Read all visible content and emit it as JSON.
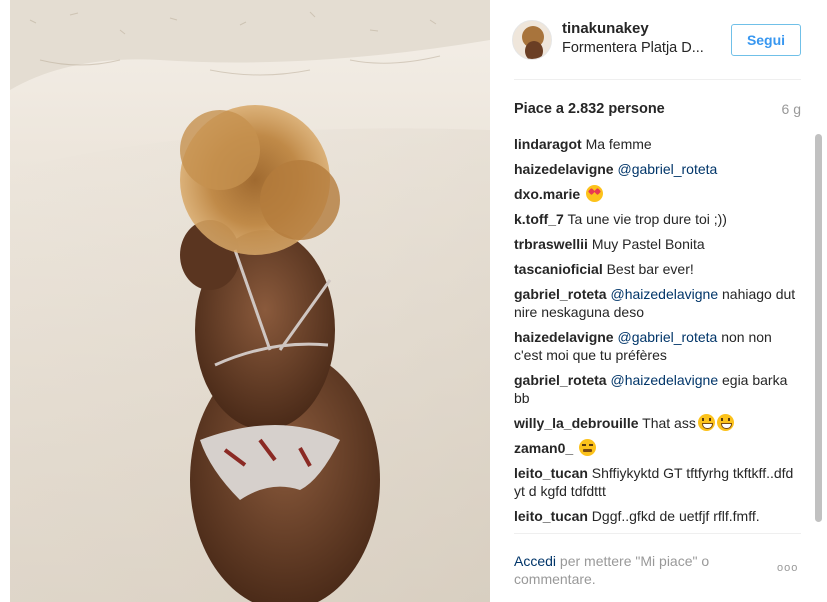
{
  "post": {
    "username": "tinakunakey",
    "location": "Formentera Platja D...",
    "follow_label": "Segui",
    "likes": "Piace a 2.832 persone",
    "time": "6 g"
  },
  "comments": [
    {
      "user": "lindaragot",
      "text": "Ma femme"
    },
    {
      "user": "haizedelavigne",
      "mention": "@gabriel_roteta",
      "text": ""
    },
    {
      "user": "dxo.marie",
      "text": "",
      "emoji": [
        "heart-eyes"
      ]
    },
    {
      "user": "k.toff_7",
      "text": "Ta une vie trop dure toi ;))"
    },
    {
      "user": "trbraswellii",
      "text": "Muy Pastel Bonita"
    },
    {
      "user": "tascanioficial",
      "text": "Best bar ever!"
    },
    {
      "user": "gabriel_roteta",
      "mention": "@haizedelavigne",
      "text": "nahiago dut nire neskaguna deso"
    },
    {
      "user": "haizedelavigne",
      "mention": "@gabriel_roteta",
      "text": "non non c'est moi que tu préfères"
    },
    {
      "user": "gabriel_roteta",
      "mention": "@haizedelavigne",
      "text": "egia barka bb"
    },
    {
      "user": "willy_la_debrouille",
      "text": "That ass",
      "emoji": [
        "grin",
        "grin"
      ]
    },
    {
      "user": "zaman0_",
      "text": "",
      "emoji": [
        "persevere"
      ]
    },
    {
      "user": "leito_tucan",
      "text": "Shffiykyktd GT tftfyrhg tkftkff..dfd yt d kgfd tdfdttt"
    },
    {
      "user": "leito_tucan",
      "text": "Dggf..gfkd de uetfjf rflf.fmff."
    }
  ],
  "footer": {
    "login_link": "Accedi",
    "login_text": "per mettere \"Mi piace\" o commentare.",
    "more_label": "ooo"
  },
  "colors": {
    "link_blue": "#3897f0",
    "mention_blue": "#003569",
    "muted": "#999999"
  },
  "icons": {
    "more": "more-options-icon"
  }
}
